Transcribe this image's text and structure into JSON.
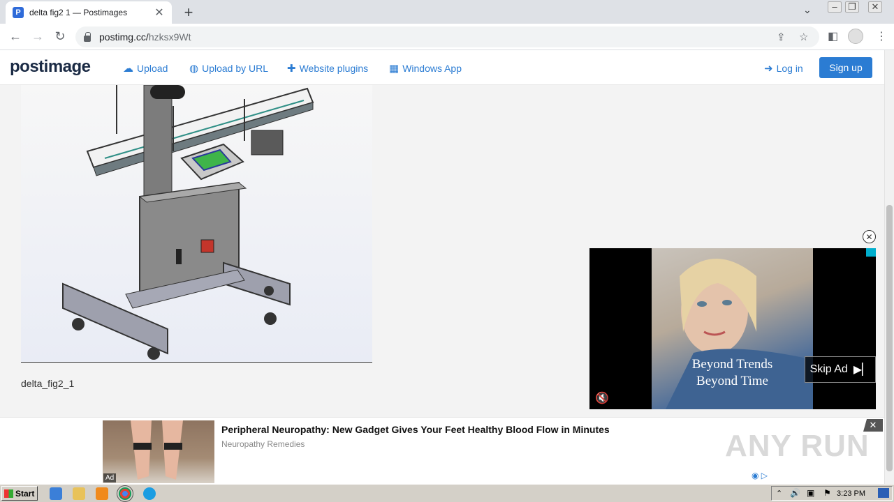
{
  "browser": {
    "tab_title": "delta fig2 1 — Postimages",
    "tab_favicon": "P",
    "new_tab": "+",
    "url_host": "postimg.cc/",
    "url_path": "hzksx9Wt"
  },
  "site": {
    "logo": "postimage",
    "nav": {
      "upload": "Upload",
      "upload_url": "Upload by URL",
      "plugins": "Website plugins",
      "windows_app": "Windows App",
      "login": "Log in",
      "signup": "Sign up"
    },
    "accent_color": "#2b7cd3"
  },
  "content": {
    "caption": "delta_fig2_1"
  },
  "video_ad": {
    "line1": "Beyond Trends",
    "line2": "Beyond Time",
    "skip_label": "Skip Ad"
  },
  "banner_ad": {
    "title": "Peripheral Neuropathy: New Gadget Gives Your Feet Healthy Blood Flow in Minutes",
    "sponsor": "Neuropathy Remedies",
    "ad_label": "Ad"
  },
  "watermark": "ANY RUN",
  "taskbar": {
    "start_label": "Start",
    "clock": "3:23 PM"
  }
}
